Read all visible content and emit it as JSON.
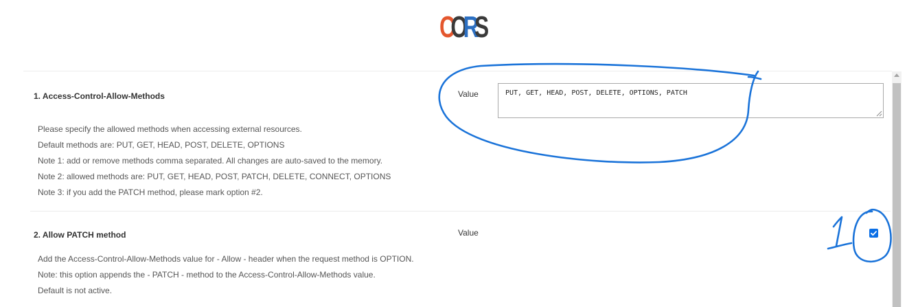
{
  "header": {
    "logo_text": "CORS",
    "logo_colors": [
      "#e4572e",
      "#3a3a3a",
      "#2c6fc1",
      "#3a3a3a"
    ]
  },
  "options": [
    {
      "title": "1. Access-Control-Allow-Methods",
      "value_label": "Value",
      "value": "PUT, GET, HEAD, POST, DELETE, OPTIONS, PATCH",
      "description": [
        "Please specify the allowed methods when accessing external resources.",
        "Default methods are: PUT, GET, HEAD, POST, DELETE, OPTIONS",
        "Note 1: add or remove methods comma separated. All changes are auto-saved to the memory.",
        "Note 2: allowed methods are: PUT, GET, HEAD, POST, PATCH, DELETE, CONNECT, OPTIONS",
        "Note 3: if you add the PATCH method, please mark option #2."
      ]
    },
    {
      "title": "2. Allow PATCH method",
      "value_label": "Value",
      "checked": true,
      "description": [
        "Add the Access-Control-Allow-Methods value for - Allow - header when the request method is OPTION.",
        "Note: this option appends the - PATCH - method to the Access-Control-Allow-Methods value.",
        "Default is not active."
      ]
    }
  ],
  "annotation": {
    "handwritten_mark": "1",
    "color": "#1a73d9"
  },
  "colors": {
    "checkbox": "#0a6fe6",
    "divider": "#ececec"
  }
}
